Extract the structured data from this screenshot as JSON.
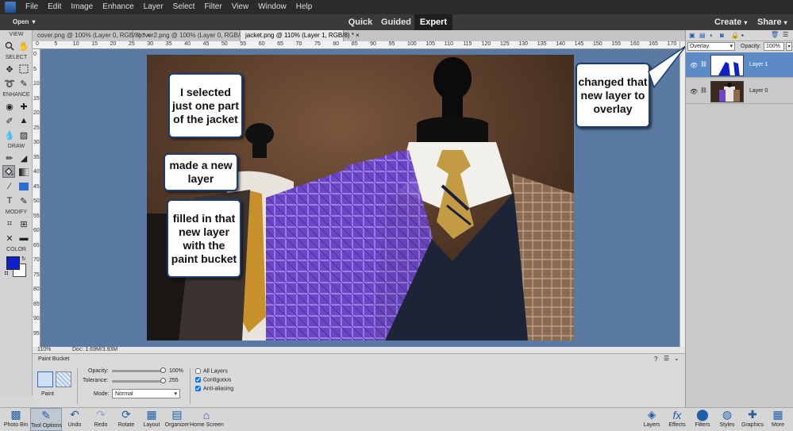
{
  "menubar": {
    "items": [
      "File",
      "Edit",
      "Image",
      "Enhance",
      "Layer",
      "Select",
      "Filter",
      "View",
      "Window",
      "Help"
    ]
  },
  "modebar": {
    "open_label": "Open",
    "open_caret": "▾",
    "modes": [
      "Quick",
      "Guided",
      "Expert"
    ],
    "active_mode": "Expert",
    "create_label": "Create",
    "share_label": "Share",
    "caret": "▾"
  },
  "doc_tabs": [
    {
      "label": "cover.png @ 100% (Layer 0, RGB/8) *",
      "close": "×"
    },
    {
      "label": "cover2.png @ 100% (Layer 0, RGB/8) *",
      "close": "×"
    },
    {
      "label": "jacket.png @ 110% (Layer 1, RGB/8) *",
      "close": "×"
    }
  ],
  "toolbox": {
    "sections": [
      "VIEW",
      "SELECT",
      "ENHANCE",
      "DRAW",
      "MODIFY",
      "COLOR"
    ],
    "foreground_color": "#1020c8",
    "background_color": "#ffffff"
  },
  "ruler": {
    "top_ticks": [
      "0",
      "5",
      "10",
      "15",
      "20",
      "25",
      "30",
      "35",
      "40",
      "45",
      "50",
      "55",
      "60",
      "65",
      "70",
      "75",
      "80",
      "85",
      "90",
      "95",
      "100",
      "105",
      "110",
      "115",
      "120",
      "125",
      "130",
      "135",
      "140",
      "145",
      "150",
      "155",
      "160",
      "165",
      "170"
    ],
    "left_ticks": [
      "0",
      "5",
      "1 0",
      "1 5",
      "2 0",
      "2 5",
      "3 0",
      "3 5",
      "4 0",
      "4 5",
      "5 0",
      "5 5",
      "6 0",
      "6 5",
      "7 0",
      "7 5",
      "8 0",
      "8 5",
      "9 0",
      "9 5"
    ]
  },
  "annotations": {
    "selected": "I selected just one part of the jacket",
    "made_layer": "made a new layer",
    "filled": "filled in that new layer with the paint bucket",
    "overlay": "changed that new layer to overlay"
  },
  "statusbar": {
    "zoom": "110%",
    "doc": "Doc: 1.69M/3.93M"
  },
  "tool_options": {
    "tool_name": "Paint Bucket",
    "paint_label": "Paint",
    "opacity_label": "Opacity:",
    "opacity_value": "100%",
    "opacity_level": 1.0,
    "tolerance_label": "Tolerance:",
    "tolerance_value": "255",
    "tolerance_level": 1.0,
    "mode_label": "Mode:",
    "mode_value": "Normal",
    "checkboxes": [
      {
        "label": "All Layers",
        "checked": false
      },
      {
        "label": "Contiguous",
        "checked": true
      },
      {
        "label": "Anti-aliasing",
        "checked": true
      }
    ]
  },
  "layers_panel": {
    "blend_mode": "Overlay",
    "opacity_label": "Opacity:",
    "opacity_value": "100%",
    "layers": [
      {
        "name": "Layer 1",
        "selected": true
      },
      {
        "name": "Layer 0",
        "selected": false
      }
    ]
  },
  "bottombar": {
    "left": [
      "Photo Bin",
      "Tool Options",
      "Undo",
      "Redo",
      "Rotate",
      "Layout",
      "Organizer",
      "Home Screen"
    ],
    "right": [
      "Layers",
      "Effects",
      "Filters",
      "Styles",
      "Graphics",
      "More"
    ],
    "active": "Tool Options"
  },
  "colors": {
    "accent": "#1f5fa8",
    "canvas_bg": "#5a7aa3",
    "selected_layer": "#5b8ac7"
  }
}
